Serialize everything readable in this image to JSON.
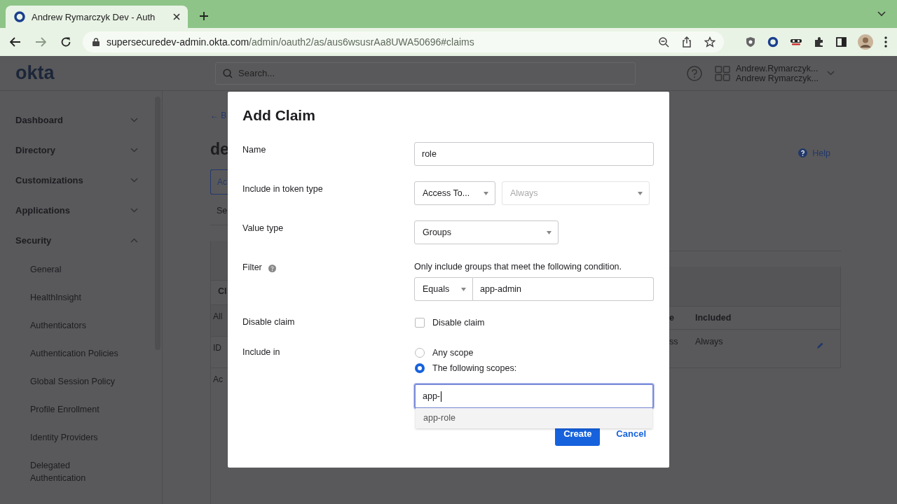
{
  "browser": {
    "tab_title": "Andrew Rymarczyk Dev - Auth",
    "url_host": "supersecuredev-admin.okta.com",
    "url_path": "/admin/oauth2/as/aus6wsusrAa8UWA50696#claims"
  },
  "header": {
    "logo": "okta",
    "search": {
      "placeholder": "Search..."
    },
    "user_lines": [
      "Andrew.Rymarczyk...",
      "Andrew Rymarczyk..."
    ]
  },
  "sidebar": {
    "items": [
      {
        "label": "Dashboard",
        "expanded": false
      },
      {
        "label": "Directory",
        "expanded": false
      },
      {
        "label": "Customizations",
        "expanded": false
      },
      {
        "label": "Applications",
        "expanded": false
      },
      {
        "label": "Security",
        "expanded": true,
        "children": [
          {
            "label": "General"
          },
          {
            "label": "HealthInsight"
          },
          {
            "label": "Authenticators"
          },
          {
            "label": "Authentication Policies"
          },
          {
            "label": "Global Session Policy"
          },
          {
            "label": "Profile Enrollment"
          },
          {
            "label": "Identity Providers"
          },
          {
            "label": "Delegated Authentication"
          }
        ]
      }
    ]
  },
  "page": {
    "back_link": "← B",
    "title": "de",
    "button": "Ac",
    "tab": "Se",
    "help": "Help",
    "table": {
      "left_header": "Cl",
      "left_rows": [
        "All",
        "ID",
        "Ac"
      ],
      "right_header": [
        "e",
        "Included"
      ],
      "right_row": [
        "ss",
        "Always"
      ]
    }
  },
  "modal": {
    "title": "Add Claim",
    "fields": [
      {
        "kind": "text",
        "label": "Name",
        "value": "role"
      },
      {
        "kind": "select_pair",
        "label": "Include in token type",
        "selects": [
          {
            "value": "Access To...",
            "disabled": false
          },
          {
            "value": "Always",
            "disabled": true
          }
        ]
      },
      {
        "kind": "select",
        "label": "Value type",
        "value": "Groups"
      },
      {
        "kind": "filter",
        "label": "Filter",
        "hint": "Only include groups that meet the following condition.",
        "operator": "Equals",
        "value": "app-admin"
      },
      {
        "kind": "checkbox",
        "label": "Disable claim",
        "option": "Disable claim",
        "checked": false
      },
      {
        "kind": "radios",
        "label": "Include in",
        "options": [
          {
            "label": "Any scope",
            "selected": false
          },
          {
            "label": "The following scopes:",
            "selected": true
          }
        ]
      },
      {
        "kind": "scope_input",
        "value": "app-",
        "focused": true,
        "suggestions": [
          "app-role"
        ]
      }
    ],
    "buttons": [
      {
        "label": "Create",
        "kind": "primary"
      },
      {
        "label": "Cancel",
        "kind": "link"
      }
    ]
  }
}
